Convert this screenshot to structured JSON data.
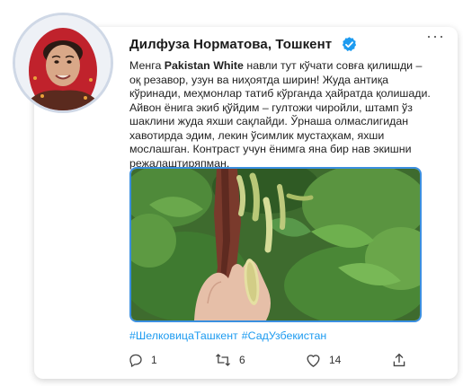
{
  "post": {
    "author_name": "Дилфуза Норматова, Тошкент",
    "more_label": "···",
    "text_before": "Менга ",
    "text_bold": "Pakistan White",
    "text_after": " навли тут кўчати совға қилишди – оқ резавор, узун ва ниҳоятда ширин! Жуда антиқа кўринади, меҳмонлар татиб кўрганда ҳайратда қолишади. Айвон ёнига экиб қўйдим – гултожи чиройли, штамп ўз шаклини жуда яхши сақлайди. Ўрнаша олмаслигидан хавотирда эдим, лекин ўсимлик мустаҳкам, яхши мослашган. Контраст учун ёнимга яна бир нав экишни режалаштиряпман.",
    "hashtags": [
      "#ШелковицаТашкент",
      "#СадУзбекистан"
    ],
    "icons": {
      "verified": "verified-badge-icon",
      "reply": "reply-icon",
      "retweet": "retweet-icon",
      "like": "heart-icon",
      "share": "share-icon"
    },
    "counts": {
      "replies": "1",
      "retweets": "6",
      "likes": "14"
    },
    "colors": {
      "accent": "#1d9bf0",
      "photo_border": "#3b8fe0"
    }
  }
}
